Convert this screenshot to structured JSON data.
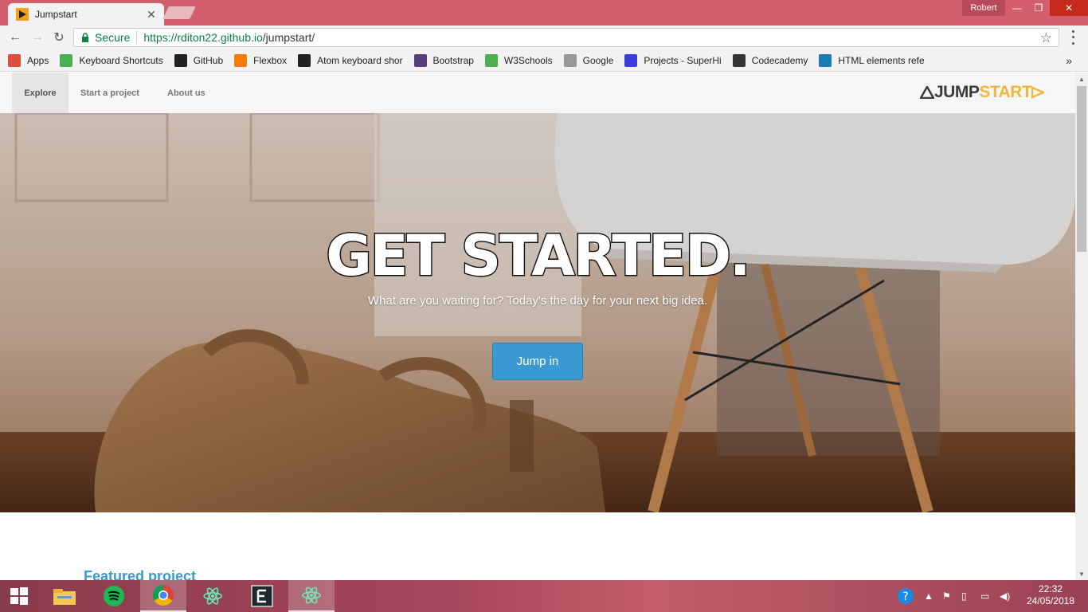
{
  "browser": {
    "tab_title": "Jumpstart",
    "profile_name": "Robert",
    "secure_label": "Secure",
    "url_host": "https://rditon22.github.io",
    "url_path": "/jumpstart/"
  },
  "bookmarks": [
    {
      "label": "Apps",
      "icon": "apps-grid-icon",
      "color": "#e04c3c"
    },
    {
      "label": "Keyboard Shortcuts",
      "icon": "w3-icon",
      "color": "#4caf50"
    },
    {
      "label": "GitHub",
      "icon": "github-icon",
      "color": "#222222"
    },
    {
      "label": "Flexbox",
      "icon": "asterisk-icon",
      "color": "#f57c00"
    },
    {
      "label": "Atom keyboard shor",
      "icon": "github-icon",
      "color": "#222222"
    },
    {
      "label": "Bootstrap",
      "icon": "bootstrap-icon",
      "color": "#563d7c"
    },
    {
      "label": "W3Schools",
      "icon": "w3-icon",
      "color": "#4caf50"
    },
    {
      "label": "Google",
      "icon": "page-icon",
      "color": "#999999"
    },
    {
      "label": "Projects - SuperHi",
      "icon": "superhi-icon",
      "color": "#3d3ddb"
    },
    {
      "label": "Codecademy",
      "icon": "codecademy-icon",
      "color": "#333333"
    },
    {
      "label": "HTML elements refe",
      "icon": "mdn-icon",
      "color": "#1d7bb8"
    }
  ],
  "site": {
    "nav": {
      "explore": "Explore",
      "start_project": "Start a project",
      "about": "About us"
    },
    "logo_jump": "JUMP",
    "logo_start": "START",
    "hero": {
      "title": "GET STARTED.",
      "subtitle": "What are you waiting for? Today's the day for your next big idea.",
      "button": "Jump in"
    },
    "featured_heading": "Featured project"
  },
  "taskbar": {
    "time": "22:32",
    "date": "24/05/2018",
    "apps": [
      "windows-start-icon",
      "file-explorer-icon",
      "spotify-icon",
      "chrome-icon",
      "atom-icon",
      "editor-icon",
      "atom-icon"
    ]
  },
  "colors": {
    "accent": "#3b99d2",
    "logo_orange": "#f1b63d",
    "titlebar": "#d35f6e"
  }
}
